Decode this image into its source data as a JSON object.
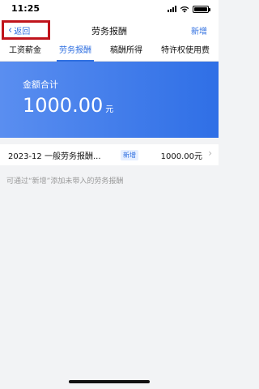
{
  "status_bar": {
    "time": "11:25"
  },
  "nav": {
    "back_label": "返回",
    "title": "劳务报酬",
    "add_label": "新增"
  },
  "tabs": [
    {
      "label": "工资薪金",
      "active": false
    },
    {
      "label": "劳务报酬",
      "active": true
    },
    {
      "label": "稿酬所得",
      "active": false
    },
    {
      "label": "特许权使用费",
      "active": false
    }
  ],
  "summary": {
    "label": "金额合计",
    "amount": "1000.00",
    "unit": "元"
  },
  "records": [
    {
      "title": "2023-12 一般劳务报酬...",
      "badge": "新增",
      "amount": "1000.00元"
    }
  ],
  "hint": "可通过“新增”添加未带入的劳务报酬",
  "colors": {
    "accent": "#2f6fe0",
    "highlight_box": "#c0141c"
  }
}
